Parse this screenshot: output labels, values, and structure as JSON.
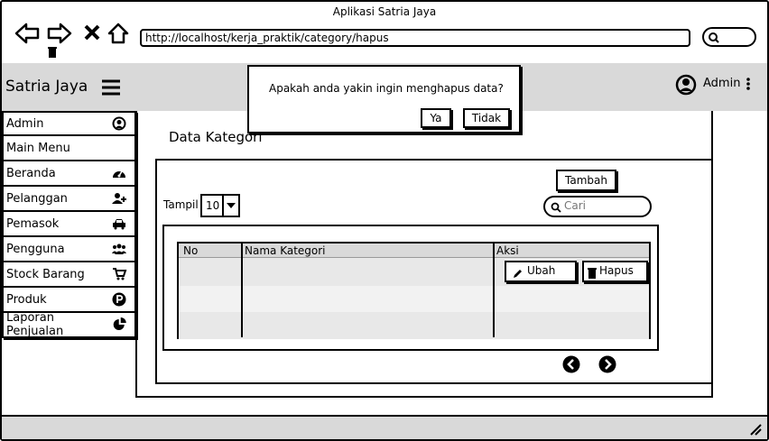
{
  "window": {
    "title": "Aplikasi Satria Jaya"
  },
  "browser": {
    "url": "http://localhost/kerja_praktik/category/hapus"
  },
  "header": {
    "brand": "Satria Jaya",
    "user": "Admin"
  },
  "sidebar": {
    "items": [
      {
        "label": "Admin",
        "icon": "user-circle-icon"
      },
      {
        "label": "Main Menu",
        "icon": ""
      },
      {
        "label": "Beranda",
        "icon": "dashboard-icon"
      },
      {
        "label": "Pelanggan",
        "icon": "add-user-icon"
      },
      {
        "label": "Pemasok",
        "icon": "car-icon"
      },
      {
        "label": "Pengguna",
        "icon": "users-icon"
      },
      {
        "label": "Stock Barang",
        "icon": "cart-icon"
      },
      {
        "label": "Produk",
        "icon": "parking-icon"
      },
      {
        "label": "Laporan Penjualan",
        "icon": "pie-chart-icon"
      }
    ]
  },
  "main": {
    "page_title": "Data Kategori",
    "add_button": "Tambah",
    "show_label": "Tampil",
    "show_value": "10",
    "search_placeholder": "Cari",
    "table": {
      "headers": [
        "No",
        "Nama Kategori",
        "Aksi"
      ],
      "edit_button": "Ubah",
      "delete_button": "Hapus"
    }
  },
  "dialog": {
    "message": "Apakah anda yakin ingin menghapus data?",
    "yes": "Ya",
    "no": "Tidak"
  }
}
